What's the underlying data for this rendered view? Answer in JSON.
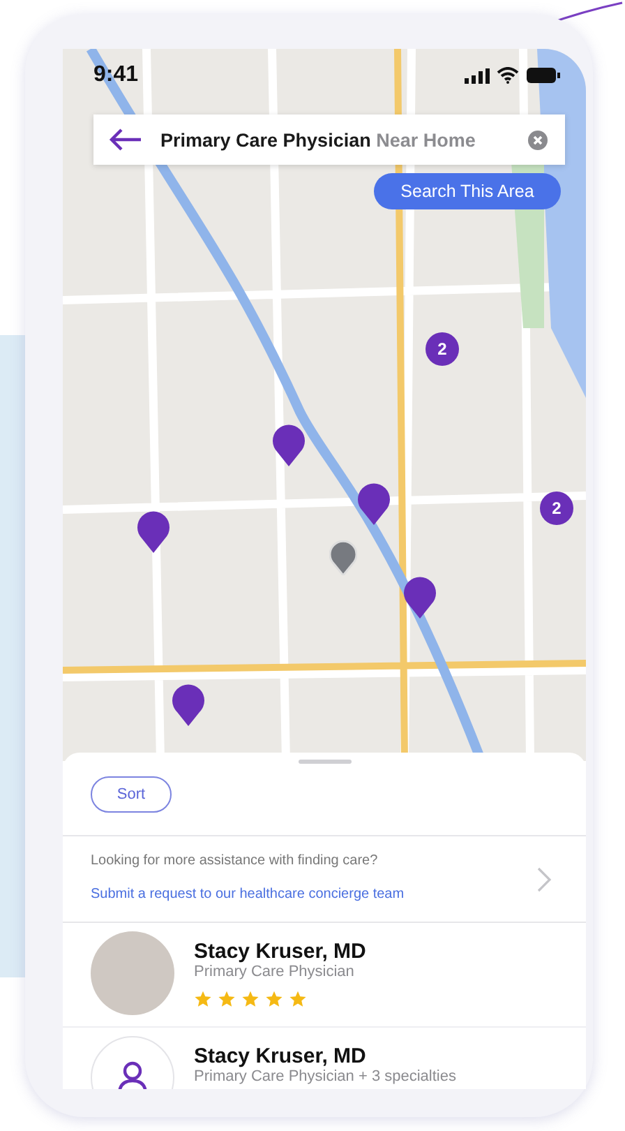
{
  "status_bar": {
    "time": "9:41"
  },
  "search": {
    "query": "Primary Care Physician",
    "location": "Near Home"
  },
  "search_area_button": "Search This Area",
  "map_pins": [
    {
      "kind": "cluster",
      "label": "2"
    },
    {
      "kind": "single"
    },
    {
      "kind": "single"
    },
    {
      "kind": "single"
    },
    {
      "kind": "cluster",
      "label": "2"
    },
    {
      "kind": "single"
    },
    {
      "kind": "single"
    },
    {
      "kind": "location"
    }
  ],
  "sort_button": "Sort",
  "assistance": {
    "question": "Looking for more assistance with finding care?",
    "link": "Submit a request to our healthcare concierge team"
  },
  "providers": [
    {
      "name": "Stacy Kruser, MD",
      "specialty": "Primary Care Physician",
      "kind": "photo",
      "stars": 5
    },
    {
      "name": "Stacy Kruser, MD",
      "specialty": "Primary Care Physician + 3 specialties",
      "kind": "generic"
    }
  ]
}
